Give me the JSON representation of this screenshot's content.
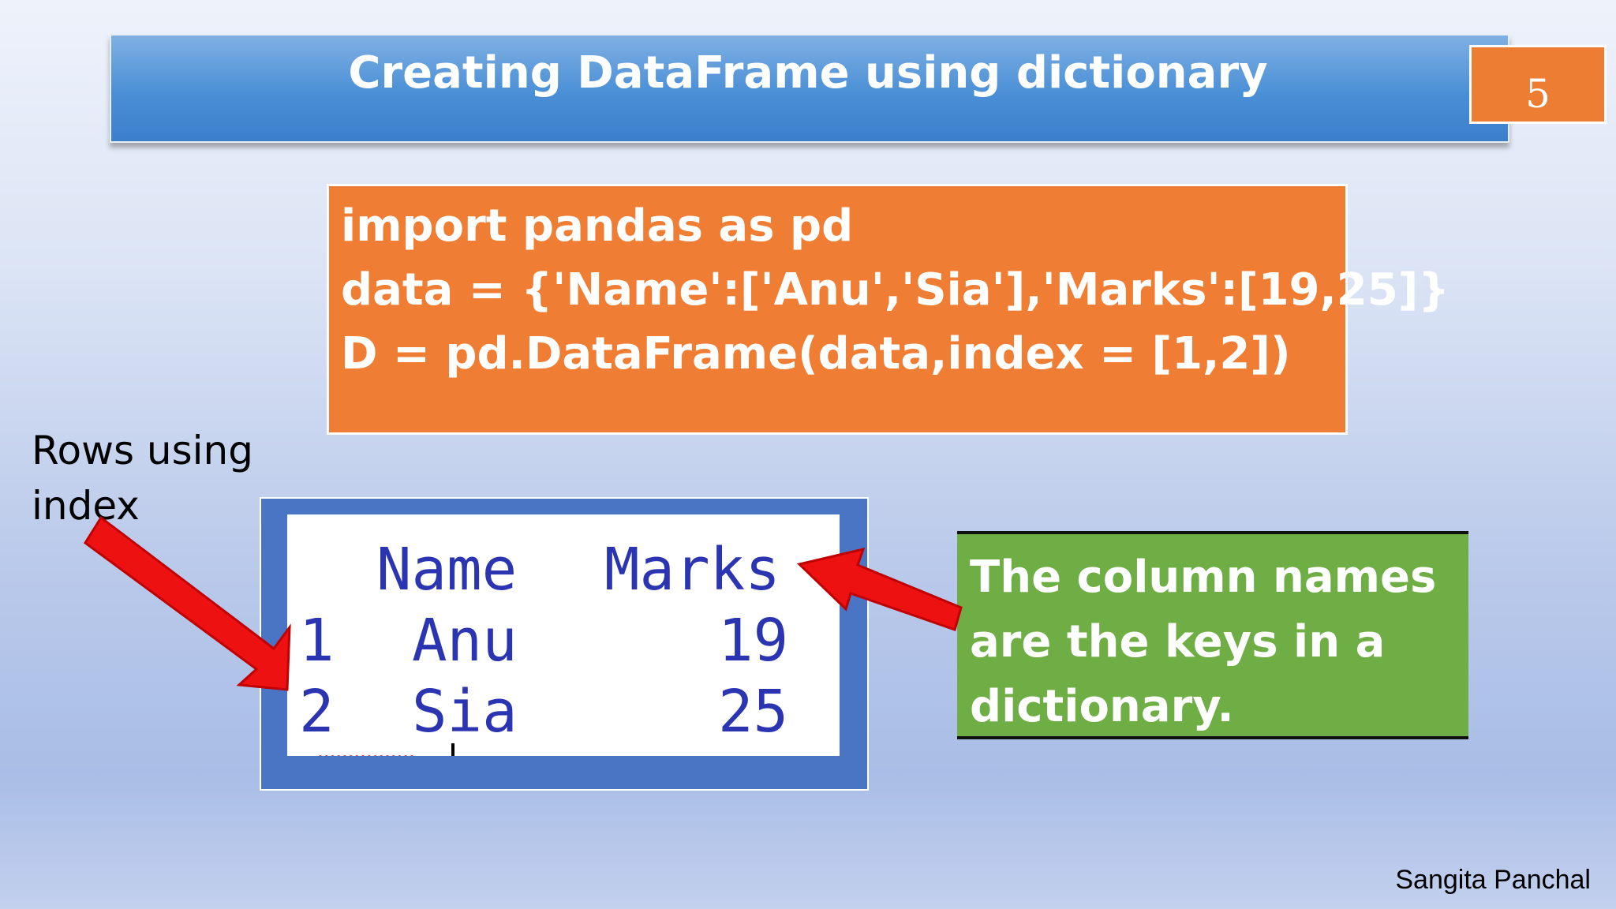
{
  "slide": {
    "title": "Creating DataFrame using dictionary",
    "page_number": "5",
    "author": "Sangita Panchal"
  },
  "code": {
    "lines": [
      "import pandas as pd",
      "data = {'Name':['Anu','Sia'],'Marks':[19,25]}",
      "D = pd.DataFrame(data,index = [1,2])"
    ]
  },
  "annotations": {
    "rows_label_line1": "Rows using",
    "rows_label_line2": "index",
    "columns_note": [
      "The column names",
      "are the keys in a",
      "dictionary."
    ]
  },
  "dataframe_output": {
    "columns": [
      "Name",
      "Marks"
    ],
    "rows": [
      {
        "index": "1",
        "Name": "Anu",
        "Marks": "19"
      },
      {
        "index": "2",
        "Name": "Sia",
        "Marks": "25"
      }
    ]
  },
  "colors": {
    "title_blue": "#4a8fd6",
    "orange": "#ef7e34",
    "green": "#6fad45",
    "frame_blue": "#4a74c4",
    "arrow_red": "#ee1111",
    "output_text": "#2b35b2"
  }
}
